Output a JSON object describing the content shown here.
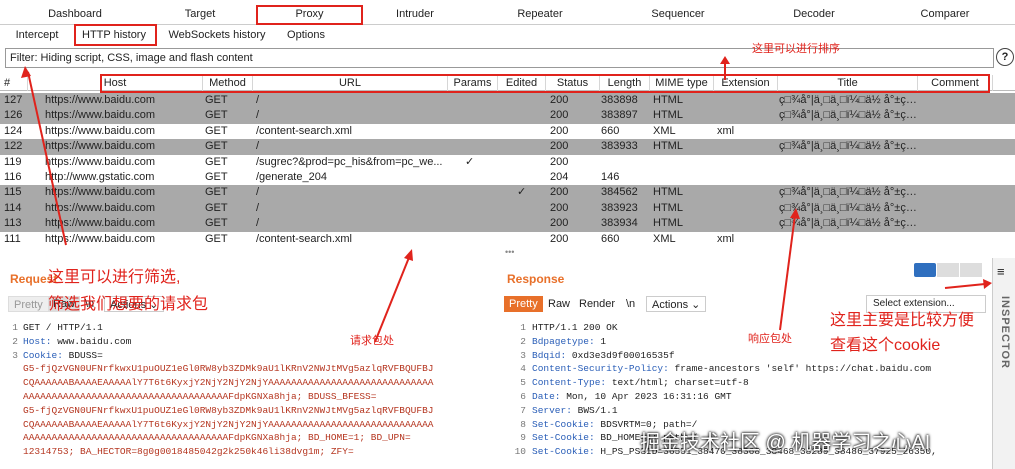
{
  "top_tabs": [
    "Dashboard",
    "Target",
    "Proxy",
    "Intruder",
    "Repeater",
    "Sequencer",
    "Decoder",
    "Comparer"
  ],
  "sub_tabs": [
    "Intercept",
    "HTTP history",
    "WebSockets history",
    "Options"
  ],
  "filter_text": "Filter: Hiding script, CSS, image and flash content",
  "help_label": "?",
  "columns": [
    "#",
    "Host",
    "Method",
    "URL",
    "Params",
    "Edited",
    "Status",
    "Length",
    "MIME type",
    "Extension",
    "Title",
    "Comment"
  ],
  "rows": [
    {
      "num": "127",
      "host": "https://www.baidu.com",
      "method": "GET",
      "url": "/",
      "params": "",
      "edited": "",
      "status": "200",
      "length": "383898",
      "mime": "HTML",
      "ext": "",
      "title": "ç□¾å°|ä¸□ä¸□ï¼□ä½  å°±ç…",
      "gray": true
    },
    {
      "num": "126",
      "host": "https://www.baidu.com",
      "method": "GET",
      "url": "/",
      "params": "",
      "edited": "",
      "status": "200",
      "length": "383897",
      "mime": "HTML",
      "ext": "",
      "title": "ç□¾å°|ä¸□ä¸□ï¼□ä½  å°±ç…",
      "gray": true
    },
    {
      "num": "124",
      "host": "https://www.baidu.com",
      "method": "GET",
      "url": "/content-search.xml",
      "params": "",
      "edited": "",
      "status": "200",
      "length": "660",
      "mime": "XML",
      "ext": "xml",
      "title": "",
      "gray": false
    },
    {
      "num": "122",
      "host": "https://www.baidu.com",
      "method": "GET",
      "url": "/",
      "params": "",
      "edited": "",
      "status": "200",
      "length": "383933",
      "mime": "HTML",
      "ext": "",
      "title": "ç□¾å°|ä¸□ä¸□ï¼□ä½  å°±ç…",
      "gray": true
    },
    {
      "num": "119",
      "host": "https://www.baidu.com",
      "method": "GET",
      "url": "/sugrec?&prod=pc_his&from=pc_we...",
      "params": "✓",
      "edited": "",
      "status": "200",
      "length": "",
      "mime": "",
      "ext": "",
      "title": "",
      "gray": false
    },
    {
      "num": "116",
      "host": "http://www.gstatic.com",
      "method": "GET",
      "url": "/generate_204",
      "params": "",
      "edited": "",
      "status": "204",
      "length": "146",
      "mime": "",
      "ext": "",
      "title": "",
      "gray": false
    },
    {
      "num": "115",
      "host": "https://www.baidu.com",
      "method": "GET",
      "url": "/",
      "params": "",
      "edited": "✓",
      "status": "200",
      "length": "384562",
      "mime": "HTML",
      "ext": "",
      "title": "ç□¾å°|ä¸□ä¸□ï¼□ä½  å°±ç…",
      "gray": true
    },
    {
      "num": "114",
      "host": "https://www.baidu.com",
      "method": "GET",
      "url": "/",
      "params": "",
      "edited": "",
      "status": "200",
      "length": "383923",
      "mime": "HTML",
      "ext": "",
      "title": "ç□¾å°|ä¸□ä¸□ï¼□ä½  å°±ç…",
      "gray": true
    },
    {
      "num": "113",
      "host": "https://www.baidu.com",
      "method": "GET",
      "url": "/",
      "params": "",
      "edited": "",
      "status": "200",
      "length": "383934",
      "mime": "HTML",
      "ext": "",
      "title": "ç□¾å°|ä¸□ä¸□ï¼□ä½  å°±ç…",
      "gray": true
    },
    {
      "num": "111",
      "host": "https://www.baidu.com",
      "method": "GET",
      "url": "/content-search.xml",
      "params": "",
      "edited": "",
      "status": "200",
      "length": "660",
      "mime": "XML",
      "ext": "xml",
      "title": "",
      "gray": false
    }
  ],
  "request": {
    "title": "Request",
    "buttons": [
      "Pretty",
      "Raw",
      "\\n",
      "Actions"
    ],
    "line_numbers": [
      "1",
      "2",
      "3",
      "",
      "",
      "",
      "",
      "",
      "",
      "",
      "",
      ""
    ],
    "lines": [
      "GET / HTTP/1.1",
      "Host: www.baidu.com",
      "Cookie: BDUSS=",
      "G5-fjQzVGN0UFNrfkwxU1puOUZ1eGl0RW8yb3ZDMk9aU1lKRnV2NWJtMVg5azlqRVFBQUFBJ",
      "CQAAAAAABAAAAEAAAAAlY7T6t6KyxjY2NjY2NjY2NjYAAAAAAAAAAAAAAAAAAAAAAAAAAAAA",
      "AAAAAAAAAAAAAAAAAAAAAAAAAAAAAAAAAAAAFdpKGNXa8hja; BDUSS_BFESS=",
      "G5-fjQzVGN0UFNrfkwxU1puOUZ1eGl0RW8yb3ZDMk9aU1lKRnV2NWJtMVg5azlqRVFBQUFBJ",
      "CQAAAAAABAAAAEAAAAAlY7T6t6KyxjY2NjY2NjY2NjYAAAAAAAAAAAAAAAAAAAAAAAAAAAAA",
      "AAAAAAAAAAAAAAAAAAAAAAAAAAAAAAAAAAAAFdpKGNXa8hja; BD_HOME=1; BD_UPN=",
      "12314753; BA_HECTOR=8g0g0018485042g2k250k46li38dvg1m; ZFY=",
      "",
      ""
    ]
  },
  "response": {
    "title": "Response",
    "buttons": [
      "Pretty",
      "Raw",
      "Render",
      "\\n",
      "Actions"
    ],
    "select_label": "Select extension...",
    "line_numbers": [
      "1",
      "2",
      "3",
      "4",
      "5",
      "6",
      "7",
      "8",
      "9",
      "10"
    ],
    "lines": [
      "HTTP/1.1 200 OK",
      "Bdpagetype: 1",
      "Bdqid: 0xd3e3d9f00016535f",
      "Content-Security-Policy: frame-ancestors 'self' https://chat.baidu.com",
      "Content-Type: text/html; charset=utf-8",
      "Date: Mon, 10 Apr 2023 16:31:16 GMT",
      "Server: BWS/1.1",
      "Set-Cookie: BDSVRTM=0; path=/",
      "Set-Cookie: BD_HOME=1; path=/",
      "Set-Cookie: H_PS_PSSID=36551_38470_38368_38468_38289_38486_37925_26350,"
    ]
  },
  "inspector_label": "INSPECTOR",
  "annotations": {
    "sort": "这里可以进行排序",
    "filter1": "这里可以进行筛选,",
    "filter2": "筛选我们想要的请求包",
    "request_pkg": "请求包处",
    "response_pkg": "响应包处",
    "cookie1": "这里主要是比较方便",
    "cookie2": "查看这个cookie"
  },
  "watermark": "掘金技术社区 @ 机器学习之心AI",
  "colors": {
    "accent": "#e8702a",
    "annotation": "#e0231c",
    "gray_row": "#a9a9a9",
    "button_orange": "#e8702a",
    "view_blue": "#2f6fbf"
  }
}
